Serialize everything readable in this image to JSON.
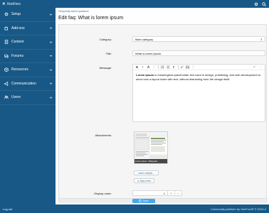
{
  "app": {
    "brand": "XenForo"
  },
  "topbar": {
    "icons": [
      "settings-icon",
      "search-icon"
    ]
  },
  "sidebar": {
    "items": [
      {
        "label": "Setup",
        "icon": "gear-icon"
      },
      {
        "label": "Add-ons",
        "icon": "puzzle-icon"
      },
      {
        "label": "Content",
        "icon": "document-icon"
      },
      {
        "label": "Forums",
        "icon": "comments-icon"
      },
      {
        "label": "Resources",
        "icon": "box-icon"
      },
      {
        "label": "Communication",
        "icon": "megaphone-icon"
      },
      {
        "label": "Users",
        "icon": "users-icon"
      }
    ]
  },
  "footer": {
    "left": "Log out",
    "right": "Community platform by XenForo® © 2010-2"
  },
  "main": {
    "breadcrumb": "Frequently asked questions",
    "title": "Edit faq: What is lorem ipsum"
  },
  "form": {
    "category": {
      "label": "Category:",
      "value": "Main category"
    },
    "title": {
      "label": "Title:",
      "value": "What is lorem ipsum"
    },
    "message": {
      "label": "Message:",
      "bold": "Lorem Ipsum",
      "text": " is meaningless placeholder text used in design, publishing, and web-development to show how a layout looks with text, without distracting from the design itself."
    },
    "attachments": {
      "label": "Attachments:",
      "thumb_caption": "Lorem ipsum - Wikipedia...",
      "insert_label": "Insert multiple...",
      "attach_label": "Attach files"
    },
    "display_order": {
      "label": "Display order:",
      "value": "1",
      "plus": "+",
      "minus": "−"
    },
    "save_label": "Save"
  },
  "colors": {
    "sidebar": "#185886",
    "accent": "#47a7eb",
    "link": "#2577b1"
  }
}
